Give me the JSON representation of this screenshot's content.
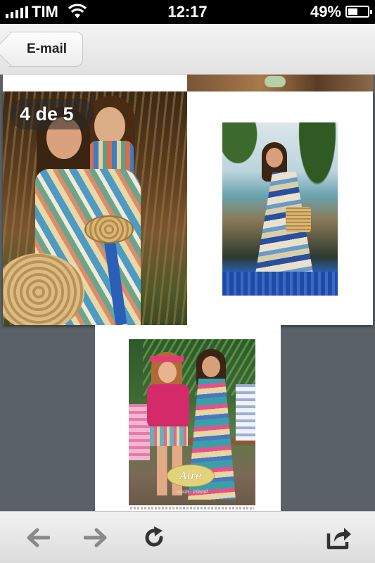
{
  "status_bar": {
    "carrier": "TIM",
    "time": "12:17",
    "battery_percent": "49%",
    "battery_level": 0.49,
    "signal_bars": 5
  },
  "nav": {
    "back_label": "E-mail"
  },
  "viewer": {
    "page_indicator": "4 de 5"
  },
  "lower_page": {
    "logo_text": "Aire",
    "tagline": "moda · infantil"
  },
  "toolbar": {
    "icons": [
      "back-arrow-icon",
      "forward-arrow-icon",
      "reload-icon",
      "share-icon"
    ]
  },
  "colors": {
    "background": "#5a6268",
    "toolbar_icon": "#8a8a8a",
    "toolbar_icon_active": "#333333"
  }
}
